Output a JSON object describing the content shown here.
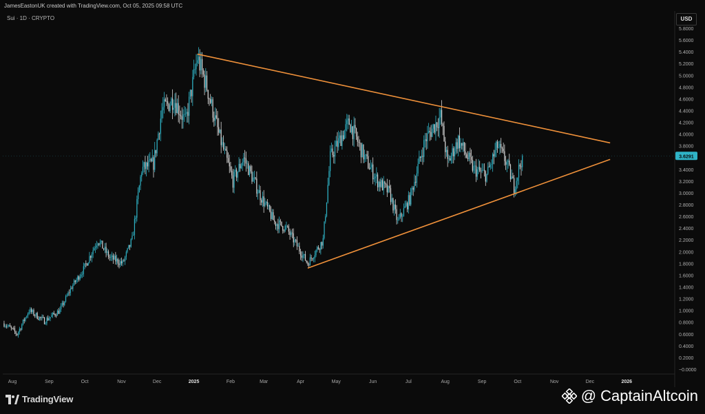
{
  "header": {
    "attribution": "JamesEastonUK created with TradingView.com, Oct 05, 2025 09:58 UTC",
    "symbol": "Sui · 1D · CRYPTO",
    "currency": "USD"
  },
  "footer": {
    "logo_text": "TradingView",
    "watermark": "@ CaptainAltcoin"
  },
  "colors": {
    "background": "#0b0b0b",
    "up_candle": "#2fb3c6",
    "down_candle": "#d9d9d9",
    "trendline": "#f0913a",
    "price_badge": "#2fb3c6"
  },
  "icons": [
    "tradingview-logo-icon",
    "binance-logo-icon"
  ],
  "chart_data": {
    "type": "candlestick",
    "title": "Sui · 1D · CRYPTO",
    "ylim": [
      -0.05,
      5.9
    ],
    "y_ticks": [
      "5.8000",
      "5.6000",
      "5.4000",
      "5.2000",
      "5.0000",
      "4.8000",
      "4.6000",
      "4.4000",
      "4.2000",
      "4.0000",
      "3.8000",
      "3.6000",
      "3.4000",
      "3.2000",
      "3.0000",
      "2.8000",
      "2.6000",
      "2.4000",
      "2.2000",
      "2.0000",
      "1.8000",
      "1.6000",
      "1.4000",
      "1.2000",
      "1.0000",
      "0.8000",
      "0.6000",
      "0.4000",
      "0.2000",
      "−0.0000"
    ],
    "x_ticks": [
      "Aug",
      "Sep",
      "Oct",
      "Nov",
      "Dec",
      "2025",
      "Feb",
      "Mar",
      "Apr",
      "May",
      "Jun",
      "Jul",
      "Aug",
      "Sep",
      "Oct",
      "Nov",
      "Dec",
      "2026"
    ],
    "x_tick_dates": [
      "2024-08-01",
      "2024-09-01",
      "2024-10-01",
      "2024-11-01",
      "2024-12-01",
      "2025-01-01",
      "2025-02-01",
      "2025-03-01",
      "2025-04-01",
      "2025-05-01",
      "2025-06-01",
      "2025-07-01",
      "2025-08-01",
      "2025-09-01",
      "2025-10-01",
      "2025-11-01",
      "2025-12-01",
      "2026-01-01"
    ],
    "last_price": "3.6291",
    "last_price_value": 3.629,
    "price_path": [
      {
        "date": "2024-07-25",
        "close": 0.78
      },
      {
        "date": "2024-08-05",
        "close": 0.6
      },
      {
        "date": "2024-08-15",
        "close": 1.0
      },
      {
        "date": "2024-08-28",
        "close": 0.82
      },
      {
        "date": "2024-09-10",
        "close": 1.0
      },
      {
        "date": "2024-09-20",
        "close": 1.4
      },
      {
        "date": "2024-09-30",
        "close": 1.7
      },
      {
        "date": "2024-10-12",
        "close": 2.2
      },
      {
        "date": "2024-10-22",
        "close": 1.9
      },
      {
        "date": "2024-11-02",
        "close": 1.8
      },
      {
        "date": "2024-11-10",
        "close": 2.2
      },
      {
        "date": "2024-11-18",
        "close": 3.4
      },
      {
        "date": "2024-11-28",
        "close": 3.5
      },
      {
        "date": "2024-12-05",
        "close": 4.4
      },
      {
        "date": "2024-12-15",
        "close": 4.6
      },
      {
        "date": "2024-12-25",
        "close": 4.2
      },
      {
        "date": "2025-01-04",
        "close": 5.3
      },
      {
        "date": "2025-01-12",
        "close": 4.8
      },
      {
        "date": "2025-01-22",
        "close": 4.0
      },
      {
        "date": "2025-02-03",
        "close": 3.2
      },
      {
        "date": "2025-02-12",
        "close": 3.6
      },
      {
        "date": "2025-02-25",
        "close": 3.0
      },
      {
        "date": "2025-03-10",
        "close": 2.5
      },
      {
        "date": "2025-03-20",
        "close": 2.4
      },
      {
        "date": "2025-04-07",
        "close": 1.8
      },
      {
        "date": "2025-04-20",
        "close": 2.2
      },
      {
        "date": "2025-04-26",
        "close": 3.6
      },
      {
        "date": "2025-05-12",
        "close": 4.2
      },
      {
        "date": "2025-05-25",
        "close": 3.6
      },
      {
        "date": "2025-06-05",
        "close": 3.2
      },
      {
        "date": "2025-06-15",
        "close": 3.0
      },
      {
        "date": "2025-06-22",
        "close": 2.5
      },
      {
        "date": "2025-07-02",
        "close": 2.9
      },
      {
        "date": "2025-07-15",
        "close": 3.9
      },
      {
        "date": "2025-07-28",
        "close": 4.3
      },
      {
        "date": "2025-08-03",
        "close": 3.5
      },
      {
        "date": "2025-08-12",
        "close": 3.9
      },
      {
        "date": "2025-08-25",
        "close": 3.4
      },
      {
        "date": "2025-09-05",
        "close": 3.3
      },
      {
        "date": "2025-09-14",
        "close": 3.8
      },
      {
        "date": "2025-09-22",
        "close": 3.5
      },
      {
        "date": "2025-09-28",
        "close": 3.1
      },
      {
        "date": "2025-10-05",
        "close": 3.63
      }
    ],
    "trendlines": [
      {
        "name": "upper",
        "from": {
          "date": "2025-01-04",
          "price": 5.36
        },
        "to": {
          "date": "2025-12-18",
          "price": 3.85
        }
      },
      {
        "name": "lower",
        "from": {
          "date": "2025-04-07",
          "price": 1.72
        },
        "to": {
          "date": "2025-12-18",
          "price": 3.57
        }
      }
    ],
    "grid": false
  }
}
